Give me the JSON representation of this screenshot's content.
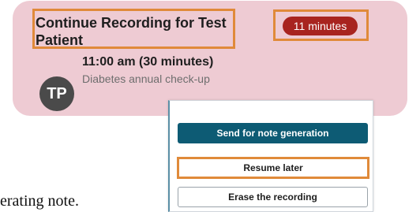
{
  "card": {
    "title": "Continue Recording for Test Patient",
    "duration_badge": "11 minutes",
    "avatar_initials": "TP",
    "appointment_time": "11:00 am (30 minutes)",
    "appointment_description": "Diabetes annual check-up"
  },
  "dialog": {
    "send_button": "Send for note generation",
    "resume_button": "Resume later",
    "erase_button": "Erase the recording"
  },
  "background_text": "erating note."
}
